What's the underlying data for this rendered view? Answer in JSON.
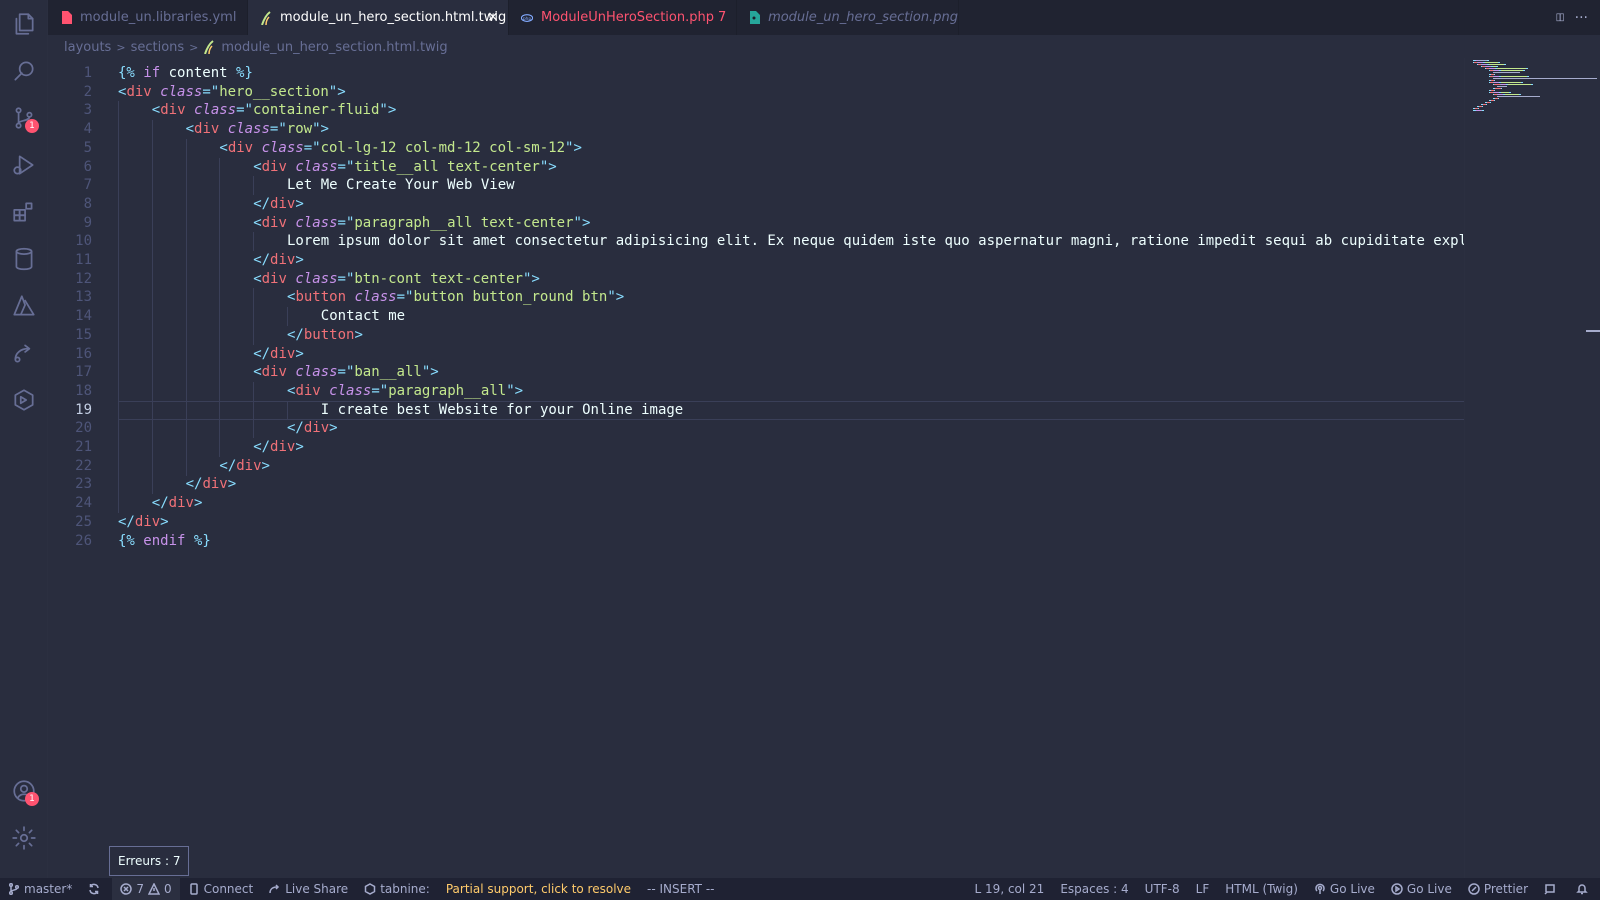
{
  "tabs": [
    {
      "name": "module_un.libraries.yml",
      "state": "inactive",
      "icon": "yaml-file-icon"
    },
    {
      "name": "module_un_hero_section.html.twig",
      "state": "active",
      "icon": "twig-file-icon"
    },
    {
      "name": "ModuleUnHeroSection.php",
      "state": "error",
      "errors": "7",
      "icon": "php-file-icon"
    },
    {
      "name": "module_un_hero_section.png",
      "state": "preview",
      "icon": "image-file-icon"
    }
  ],
  "tab_close_glyph": "×",
  "tab_actions": {
    "split": "▯▯",
    "more": "···"
  },
  "breadcrumb": [
    "layouts",
    "sections",
    "module_un_hero_section.html.twig"
  ],
  "editor": {
    "current_line": 19,
    "lines": [
      {
        "n": "1",
        "indent": 0,
        "tokens": [
          [
            "t-pun",
            "{% "
          ],
          [
            "t-kw",
            "if"
          ],
          [
            "t-txt",
            " content "
          ],
          [
            "t-pun",
            "%}"
          ]
        ]
      },
      {
        "n": "2",
        "indent": 0,
        "tokens": [
          [
            "t-pun",
            "<"
          ],
          [
            "t-tag",
            "div"
          ],
          [
            "t-txt",
            " "
          ],
          [
            "t-attr",
            "class"
          ],
          [
            "t-pun",
            "=\""
          ],
          [
            "t-str",
            "hero__section"
          ],
          [
            "t-pun",
            "\">"
          ]
        ]
      },
      {
        "n": "3",
        "indent": 1,
        "tokens": [
          [
            "t-pun",
            "<"
          ],
          [
            "t-tag",
            "div"
          ],
          [
            "t-txt",
            " "
          ],
          [
            "t-attr",
            "class"
          ],
          [
            "t-pun",
            "=\""
          ],
          [
            "t-str",
            "container-fluid"
          ],
          [
            "t-pun",
            "\">"
          ]
        ]
      },
      {
        "n": "4",
        "indent": 2,
        "tokens": [
          [
            "t-pun",
            "<"
          ],
          [
            "t-tag",
            "div"
          ],
          [
            "t-txt",
            " "
          ],
          [
            "t-attr",
            "class"
          ],
          [
            "t-pun",
            "=\""
          ],
          [
            "t-str",
            "row"
          ],
          [
            "t-pun",
            "\">"
          ]
        ]
      },
      {
        "n": "5",
        "indent": 3,
        "tokens": [
          [
            "t-pun",
            "<"
          ],
          [
            "t-tag",
            "div"
          ],
          [
            "t-txt",
            " "
          ],
          [
            "t-attr",
            "class"
          ],
          [
            "t-pun",
            "=\""
          ],
          [
            "t-str",
            "col-lg-12 col-md-12 col-sm-12"
          ],
          [
            "t-pun",
            "\">"
          ]
        ]
      },
      {
        "n": "6",
        "indent": 4,
        "tokens": [
          [
            "t-pun",
            "<"
          ],
          [
            "t-tag",
            "div"
          ],
          [
            "t-txt",
            " "
          ],
          [
            "t-attr",
            "class"
          ],
          [
            "t-pun",
            "=\""
          ],
          [
            "t-str",
            "title__all text-center"
          ],
          [
            "t-pun",
            "\">"
          ]
        ]
      },
      {
        "n": "7",
        "indent": 5,
        "tokens": [
          [
            "t-txt",
            "Let Me Create Your Web View"
          ]
        ]
      },
      {
        "n": "8",
        "indent": 4,
        "tokens": [
          [
            "t-pun",
            "</"
          ],
          [
            "t-tag",
            "div"
          ],
          [
            "t-pun",
            ">"
          ]
        ]
      },
      {
        "n": "9",
        "indent": 4,
        "tokens": [
          [
            "t-pun",
            "<"
          ],
          [
            "t-tag",
            "div"
          ],
          [
            "t-txt",
            " "
          ],
          [
            "t-attr",
            "class"
          ],
          [
            "t-pun",
            "=\""
          ],
          [
            "t-str",
            "paragraph__all text-center"
          ],
          [
            "t-pun",
            "\">"
          ]
        ]
      },
      {
        "n": "10",
        "indent": 5,
        "tokens": [
          [
            "t-txt",
            "Lorem ipsum dolor sit amet consectetur adipisicing elit. Ex neque quidem iste quo aspernatur magni, ratione impedit sequi ab cupiditate expl"
          ]
        ]
      },
      {
        "n": "11",
        "indent": 4,
        "tokens": [
          [
            "t-pun",
            "</"
          ],
          [
            "t-tag",
            "div"
          ],
          [
            "t-pun",
            ">"
          ]
        ]
      },
      {
        "n": "12",
        "indent": 4,
        "tokens": [
          [
            "t-pun",
            "<"
          ],
          [
            "t-tag",
            "div"
          ],
          [
            "t-txt",
            " "
          ],
          [
            "t-attr",
            "class"
          ],
          [
            "t-pun",
            "=\""
          ],
          [
            "t-str",
            "btn-cont text-center"
          ],
          [
            "t-pun",
            "\">"
          ]
        ]
      },
      {
        "n": "13",
        "indent": 5,
        "tokens": [
          [
            "t-pun",
            "<"
          ],
          [
            "t-tag",
            "button"
          ],
          [
            "t-txt",
            " "
          ],
          [
            "t-attr",
            "class"
          ],
          [
            "t-pun",
            "=\""
          ],
          [
            "t-str",
            "button button_round btn"
          ],
          [
            "t-pun",
            "\">"
          ]
        ]
      },
      {
        "n": "14",
        "indent": 6,
        "tokens": [
          [
            "t-txt",
            "Contact me"
          ]
        ]
      },
      {
        "n": "15",
        "indent": 5,
        "tokens": [
          [
            "t-pun",
            "</"
          ],
          [
            "t-tag",
            "button"
          ],
          [
            "t-pun",
            ">"
          ]
        ]
      },
      {
        "n": "16",
        "indent": 4,
        "tokens": [
          [
            "t-pun",
            "</"
          ],
          [
            "t-tag",
            "div"
          ],
          [
            "t-pun",
            ">"
          ]
        ]
      },
      {
        "n": "17",
        "indent": 4,
        "tokens": [
          [
            "t-pun",
            "<"
          ],
          [
            "t-tag",
            "div"
          ],
          [
            "t-txt",
            " "
          ],
          [
            "t-attr",
            "class"
          ],
          [
            "t-pun",
            "=\""
          ],
          [
            "t-str",
            "ban__all"
          ],
          [
            "t-pun",
            "\">"
          ]
        ]
      },
      {
        "n": "18",
        "indent": 5,
        "tokens": [
          [
            "t-pun",
            "<"
          ],
          [
            "t-tag",
            "div"
          ],
          [
            "t-txt",
            " "
          ],
          [
            "t-attr",
            "class"
          ],
          [
            "t-pun",
            "=\""
          ],
          [
            "t-str",
            "paragraph__all"
          ],
          [
            "t-pun",
            "\">"
          ]
        ]
      },
      {
        "n": "19",
        "indent": 6,
        "tokens": [
          [
            "t-txt",
            "I create best Website for your Online image"
          ]
        ]
      },
      {
        "n": "20",
        "indent": 5,
        "tokens": [
          [
            "t-pun",
            "</"
          ],
          [
            "t-tag",
            "div"
          ],
          [
            "t-pun",
            ">"
          ]
        ]
      },
      {
        "n": "21",
        "indent": 4,
        "tokens": [
          [
            "t-pun",
            "</"
          ],
          [
            "t-tag",
            "div"
          ],
          [
            "t-pun",
            ">"
          ]
        ]
      },
      {
        "n": "22",
        "indent": 3,
        "tokens": [
          [
            "t-pun",
            "</"
          ],
          [
            "t-tag",
            "div"
          ],
          [
            "t-pun",
            ">"
          ]
        ]
      },
      {
        "n": "23",
        "indent": 2,
        "tokens": [
          [
            "t-pun",
            "</"
          ],
          [
            "t-tag",
            "div"
          ],
          [
            "t-pun",
            ">"
          ]
        ]
      },
      {
        "n": "24",
        "indent": 1,
        "tokens": [
          [
            "t-pun",
            "</"
          ],
          [
            "t-tag",
            "div"
          ],
          [
            "t-pun",
            ">"
          ]
        ]
      },
      {
        "n": "25",
        "indent": 0,
        "tokens": [
          [
            "t-pun",
            "</"
          ],
          [
            "t-tag",
            "div"
          ],
          [
            "t-pun",
            ">"
          ]
        ]
      },
      {
        "n": "26",
        "indent": 0,
        "tokens": [
          [
            "t-pun",
            "{% "
          ],
          [
            "t-kw",
            "endif"
          ],
          [
            "t-txt",
            " "
          ],
          [
            "t-pun",
            "%}"
          ]
        ]
      }
    ]
  },
  "activity": {
    "explorer": "files-icon",
    "search": "search-icon",
    "scm": "source-control-icon",
    "scm_badge": "1",
    "run": "run-debug-icon",
    "extensions": "extensions-icon",
    "database": "database-icon",
    "azure": "azure-icon",
    "liveshare": "live-share-icon",
    "remote": "remote-explorer-icon",
    "accounts": "accounts-icon",
    "accounts_badge": "1",
    "settings": "gear-icon"
  },
  "tooltip": "Erreurs : 7",
  "status": {
    "branch": "master*",
    "errors": "7",
    "warnings": "0",
    "connect": "Connect",
    "live_share": "Live Share",
    "tabnine": "tabnine:",
    "tabnine_msg": "Partial support, click to resolve",
    "mode": "-- INSERT --",
    "position": "L 19, col 21",
    "spaces": "Espaces : 4",
    "encoding": "UTF-8",
    "eol": "LF",
    "language": "HTML (Twig)",
    "go_live_1": "Go Live",
    "go_live_2": "Go Live",
    "prettier": "Prettier"
  },
  "colors": {
    "background": "#292d3e",
    "tag": "#f07178",
    "attribute": "#c792ea",
    "string": "#c3e88d",
    "punctuation": "#89ddff",
    "error": "#ff5370",
    "warning_text": "#ffcb6b"
  }
}
